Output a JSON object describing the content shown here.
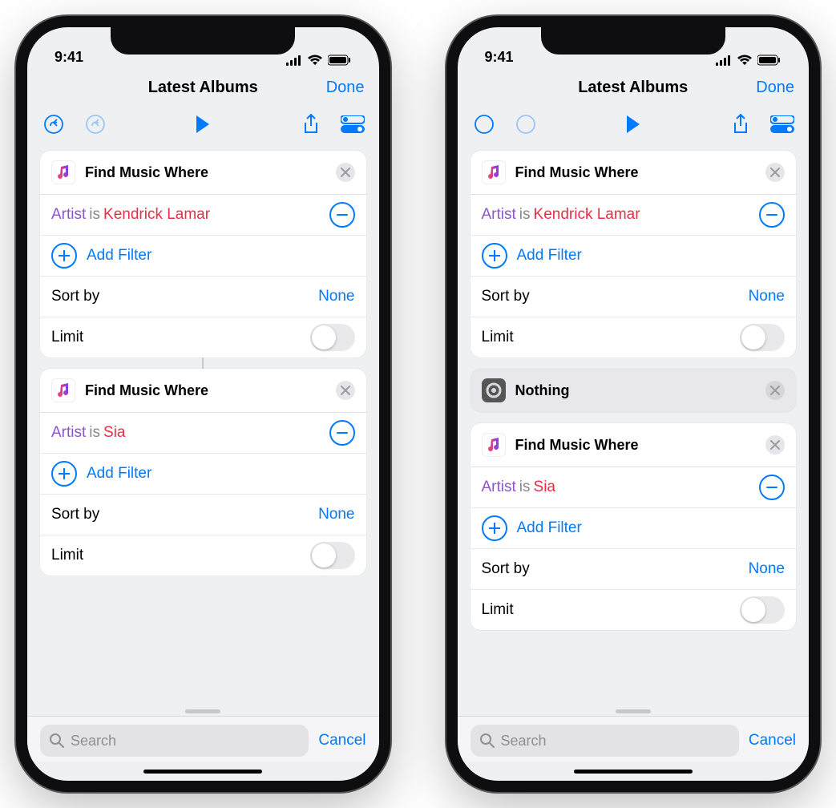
{
  "status": {
    "time": "9:41"
  },
  "nav": {
    "title": "Latest Albums",
    "done": "Done"
  },
  "labels": {
    "add_filter": "Add Filter",
    "sort_by": "Sort by",
    "none": "None",
    "limit": "Limit",
    "search_placeholder": "Search",
    "cancel": "Cancel"
  },
  "phones": [
    {
      "cards": [
        {
          "type": "find",
          "title": "Find Music Where",
          "artist_attr": "Artist",
          "artist_op": "is",
          "artist_val": "Kendrick Lamar",
          "sort_val": "None",
          "limit_on": false,
          "connected": true
        },
        {
          "type": "find",
          "title": "Find Music Where",
          "artist_attr": "Artist",
          "artist_op": "is",
          "artist_val": "Sia",
          "sort_val": "None",
          "limit_on": false,
          "connected": false
        }
      ]
    },
    {
      "cards": [
        {
          "type": "find",
          "title": "Find Music Where",
          "artist_attr": "Artist",
          "artist_op": "is",
          "artist_val": "Kendrick Lamar",
          "sort_val": "None",
          "limit_on": false,
          "connected": false
        },
        {
          "type": "nothing",
          "title": "Nothing"
        },
        {
          "type": "find",
          "title": "Find Music Where",
          "artist_attr": "Artist",
          "artist_op": "is",
          "artist_val": "Sia",
          "sort_val": "None",
          "limit_on": false,
          "connected": false
        }
      ]
    }
  ]
}
